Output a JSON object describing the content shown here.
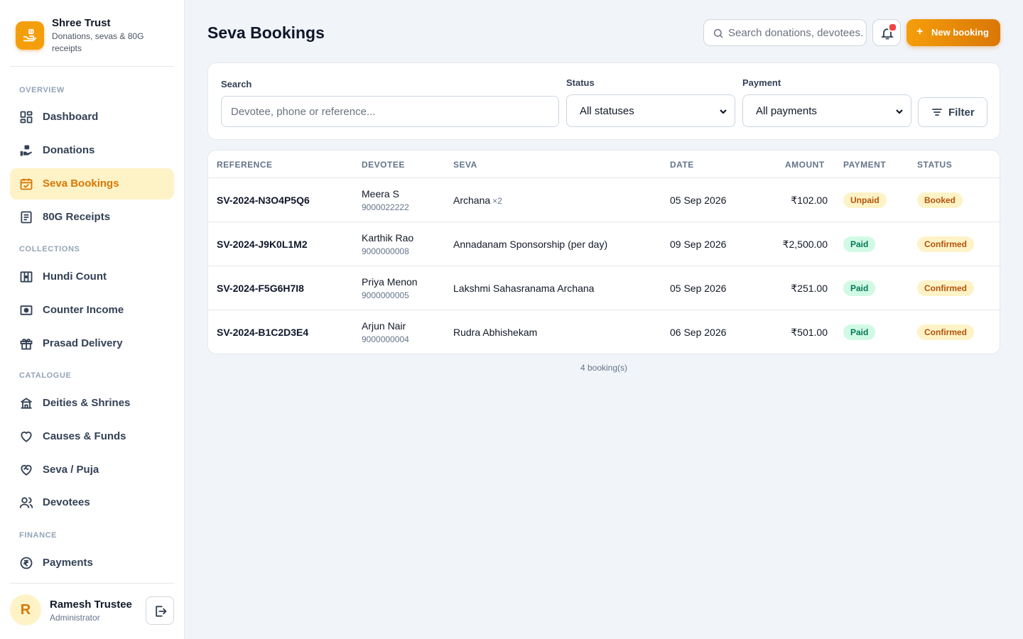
{
  "brand": {
    "name": "Shree Trust",
    "subtitle": "Donations, sevas & 80G receipts"
  },
  "sidebar": {
    "sections": {
      "overview": "OVERVIEW",
      "collections": "COLLECTIONS",
      "catalogue": "CATALOGUE",
      "finance": "FINANCE"
    },
    "items": {
      "dashboard": "Dashboard",
      "donations": "Donations",
      "seva_bookings": "Seva Bookings",
      "receipts_80g": "80G Receipts",
      "hundi_count": "Hundi Count",
      "counter_income": "Counter Income",
      "prasad_delivery": "Prasad Delivery",
      "deities_shrines": "Deities & Shrines",
      "causes_funds": "Causes & Funds",
      "seva_puja": "Seva / Puja",
      "devotees": "Devotees",
      "payments": "Payments"
    },
    "active": "seva_bookings",
    "accent_color": "#d97706"
  },
  "user": {
    "initial": "R",
    "name": "Ramesh Trustee",
    "role": "Administrator"
  },
  "header": {
    "title": "Seva Bookings",
    "search_placeholder": "Search donations, devotees...",
    "new_button": "New booking"
  },
  "filters": {
    "search_label": "Search",
    "search_placeholder": "Devotee, phone or reference...",
    "status_label": "Status",
    "status_value": "All statuses",
    "payment_label": "Payment",
    "payment_value": "All payments",
    "filter_button": "Filter"
  },
  "table": {
    "columns": {
      "reference": "REFERENCE",
      "devotee": "DEVOTEE",
      "seva": "SEVA",
      "date": "DATE",
      "amount": "AMOUNT",
      "payment": "PAYMENT",
      "status": "STATUS"
    },
    "rows": [
      {
        "reference": "SV-2024-N3O4P5Q6",
        "devotee": "Meera S",
        "phone": "9000022222",
        "seva": "Archana",
        "qty": "×2",
        "date": "05 Sep 2026",
        "amount": "₹102.00",
        "payment": "Unpaid",
        "status": "Booked"
      },
      {
        "reference": "SV-2024-J9K0L1M2",
        "devotee": "Karthik Rao",
        "phone": "9000000008",
        "seva": "Annadanam Sponsorship (per day)",
        "qty": "",
        "date": "09 Sep 2026",
        "amount": "₹2,500.00",
        "payment": "Paid",
        "status": "Confirmed"
      },
      {
        "reference": "SV-2024-F5G6H7I8",
        "devotee": "Priya Menon",
        "phone": "9000000005",
        "seva": "Lakshmi Sahasranama Archana",
        "qty": "",
        "date": "05 Sep 2026",
        "amount": "₹251.00",
        "payment": "Paid",
        "status": "Confirmed"
      },
      {
        "reference": "SV-2024-B1C2D3E4",
        "devotee": "Arjun Nair",
        "phone": "9000000004",
        "seva": "Rudra Abhishekam",
        "qty": "",
        "date": "06 Sep 2026",
        "amount": "₹501.00",
        "payment": "Paid",
        "status": "Confirmed"
      }
    ],
    "count_text": "4 booking(s)"
  }
}
